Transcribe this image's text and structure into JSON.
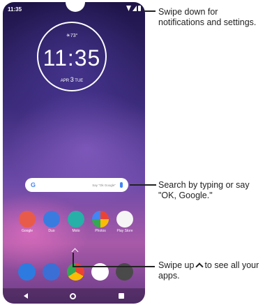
{
  "status_bar": {
    "time": "11:35"
  },
  "clock_widget": {
    "weather": "☀73°",
    "time": "11:35",
    "date_month": "APR",
    "date_day": "3",
    "date_weekday": "TUE"
  },
  "search_bar": {
    "logo": "G",
    "hint": "Say \"Ok Google\""
  },
  "home_apps": [
    {
      "label": "Google",
      "color": "#e85b4a",
      "icon": "google-folder-icon"
    },
    {
      "label": "Duo",
      "color": "#3a7be0",
      "icon": "duo-icon"
    },
    {
      "label": "Moto",
      "color": "#26b0a8",
      "icon": "moto-icon"
    },
    {
      "label": "Photos",
      "color": "#f2f2f2",
      "icon": "photos-icon"
    },
    {
      "label": "Play Store",
      "color": "#f5f5f5",
      "icon": "play-store-icon"
    }
  ],
  "dock_apps": [
    {
      "label": "Phone",
      "color": "#2d7be0",
      "icon": "phone-icon"
    },
    {
      "label": "Messages",
      "color": "#3b6fd6",
      "icon": "messages-icon"
    },
    {
      "label": "Chrome",
      "color": "#e9e9e9",
      "icon": "chrome-icon"
    },
    {
      "label": "Google",
      "color": "#ffffff",
      "icon": "google-icon"
    },
    {
      "label": "Camera",
      "color": "#4a4a4a",
      "icon": "camera-icon"
    }
  ],
  "callouts": {
    "notifications": "Swipe down for notifications and settings.",
    "search": "Search by typing or say \"OK, Google.\"",
    "apps_prefix": "Swipe up",
    "apps_suffix": "to see all your apps."
  }
}
